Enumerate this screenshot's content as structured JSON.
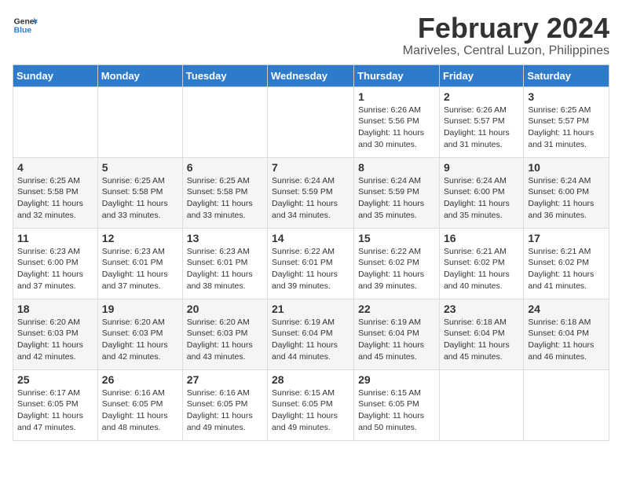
{
  "logo": {
    "line1": "General",
    "line2": "Blue"
  },
  "title": "February 2024",
  "location": "Mariveles, Central Luzon, Philippines",
  "days_header": [
    "Sunday",
    "Monday",
    "Tuesday",
    "Wednesday",
    "Thursday",
    "Friday",
    "Saturday"
  ],
  "weeks": [
    [
      {
        "day": "",
        "info": ""
      },
      {
        "day": "",
        "info": ""
      },
      {
        "day": "",
        "info": ""
      },
      {
        "day": "",
        "info": ""
      },
      {
        "day": "1",
        "info": "Sunrise: 6:26 AM\nSunset: 5:56 PM\nDaylight: 11 hours\nand 30 minutes."
      },
      {
        "day": "2",
        "info": "Sunrise: 6:26 AM\nSunset: 5:57 PM\nDaylight: 11 hours\nand 31 minutes."
      },
      {
        "day": "3",
        "info": "Sunrise: 6:25 AM\nSunset: 5:57 PM\nDaylight: 11 hours\nand 31 minutes."
      }
    ],
    [
      {
        "day": "4",
        "info": "Sunrise: 6:25 AM\nSunset: 5:58 PM\nDaylight: 11 hours\nand 32 minutes."
      },
      {
        "day": "5",
        "info": "Sunrise: 6:25 AM\nSunset: 5:58 PM\nDaylight: 11 hours\nand 33 minutes."
      },
      {
        "day": "6",
        "info": "Sunrise: 6:25 AM\nSunset: 5:58 PM\nDaylight: 11 hours\nand 33 minutes."
      },
      {
        "day": "7",
        "info": "Sunrise: 6:24 AM\nSunset: 5:59 PM\nDaylight: 11 hours\nand 34 minutes."
      },
      {
        "day": "8",
        "info": "Sunrise: 6:24 AM\nSunset: 5:59 PM\nDaylight: 11 hours\nand 35 minutes."
      },
      {
        "day": "9",
        "info": "Sunrise: 6:24 AM\nSunset: 6:00 PM\nDaylight: 11 hours\nand 35 minutes."
      },
      {
        "day": "10",
        "info": "Sunrise: 6:24 AM\nSunset: 6:00 PM\nDaylight: 11 hours\nand 36 minutes."
      }
    ],
    [
      {
        "day": "11",
        "info": "Sunrise: 6:23 AM\nSunset: 6:00 PM\nDaylight: 11 hours\nand 37 minutes."
      },
      {
        "day": "12",
        "info": "Sunrise: 6:23 AM\nSunset: 6:01 PM\nDaylight: 11 hours\nand 37 minutes."
      },
      {
        "day": "13",
        "info": "Sunrise: 6:23 AM\nSunset: 6:01 PM\nDaylight: 11 hours\nand 38 minutes."
      },
      {
        "day": "14",
        "info": "Sunrise: 6:22 AM\nSunset: 6:01 PM\nDaylight: 11 hours\nand 39 minutes."
      },
      {
        "day": "15",
        "info": "Sunrise: 6:22 AM\nSunset: 6:02 PM\nDaylight: 11 hours\nand 39 minutes."
      },
      {
        "day": "16",
        "info": "Sunrise: 6:21 AM\nSunset: 6:02 PM\nDaylight: 11 hours\nand 40 minutes."
      },
      {
        "day": "17",
        "info": "Sunrise: 6:21 AM\nSunset: 6:02 PM\nDaylight: 11 hours\nand 41 minutes."
      }
    ],
    [
      {
        "day": "18",
        "info": "Sunrise: 6:20 AM\nSunset: 6:03 PM\nDaylight: 11 hours\nand 42 minutes."
      },
      {
        "day": "19",
        "info": "Sunrise: 6:20 AM\nSunset: 6:03 PM\nDaylight: 11 hours\nand 42 minutes."
      },
      {
        "day": "20",
        "info": "Sunrise: 6:20 AM\nSunset: 6:03 PM\nDaylight: 11 hours\nand 43 minutes."
      },
      {
        "day": "21",
        "info": "Sunrise: 6:19 AM\nSunset: 6:04 PM\nDaylight: 11 hours\nand 44 minutes."
      },
      {
        "day": "22",
        "info": "Sunrise: 6:19 AM\nSunset: 6:04 PM\nDaylight: 11 hours\nand 45 minutes."
      },
      {
        "day": "23",
        "info": "Sunrise: 6:18 AM\nSunset: 6:04 PM\nDaylight: 11 hours\nand 45 minutes."
      },
      {
        "day": "24",
        "info": "Sunrise: 6:18 AM\nSunset: 6:04 PM\nDaylight: 11 hours\nand 46 minutes."
      }
    ],
    [
      {
        "day": "25",
        "info": "Sunrise: 6:17 AM\nSunset: 6:05 PM\nDaylight: 11 hours\nand 47 minutes."
      },
      {
        "day": "26",
        "info": "Sunrise: 6:16 AM\nSunset: 6:05 PM\nDaylight: 11 hours\nand 48 minutes."
      },
      {
        "day": "27",
        "info": "Sunrise: 6:16 AM\nSunset: 6:05 PM\nDaylight: 11 hours\nand 49 minutes."
      },
      {
        "day": "28",
        "info": "Sunrise: 6:15 AM\nSunset: 6:05 PM\nDaylight: 11 hours\nand 49 minutes."
      },
      {
        "day": "29",
        "info": "Sunrise: 6:15 AM\nSunset: 6:05 PM\nDaylight: 11 hours\nand 50 minutes."
      },
      {
        "day": "",
        "info": ""
      },
      {
        "day": "",
        "info": ""
      }
    ]
  ]
}
